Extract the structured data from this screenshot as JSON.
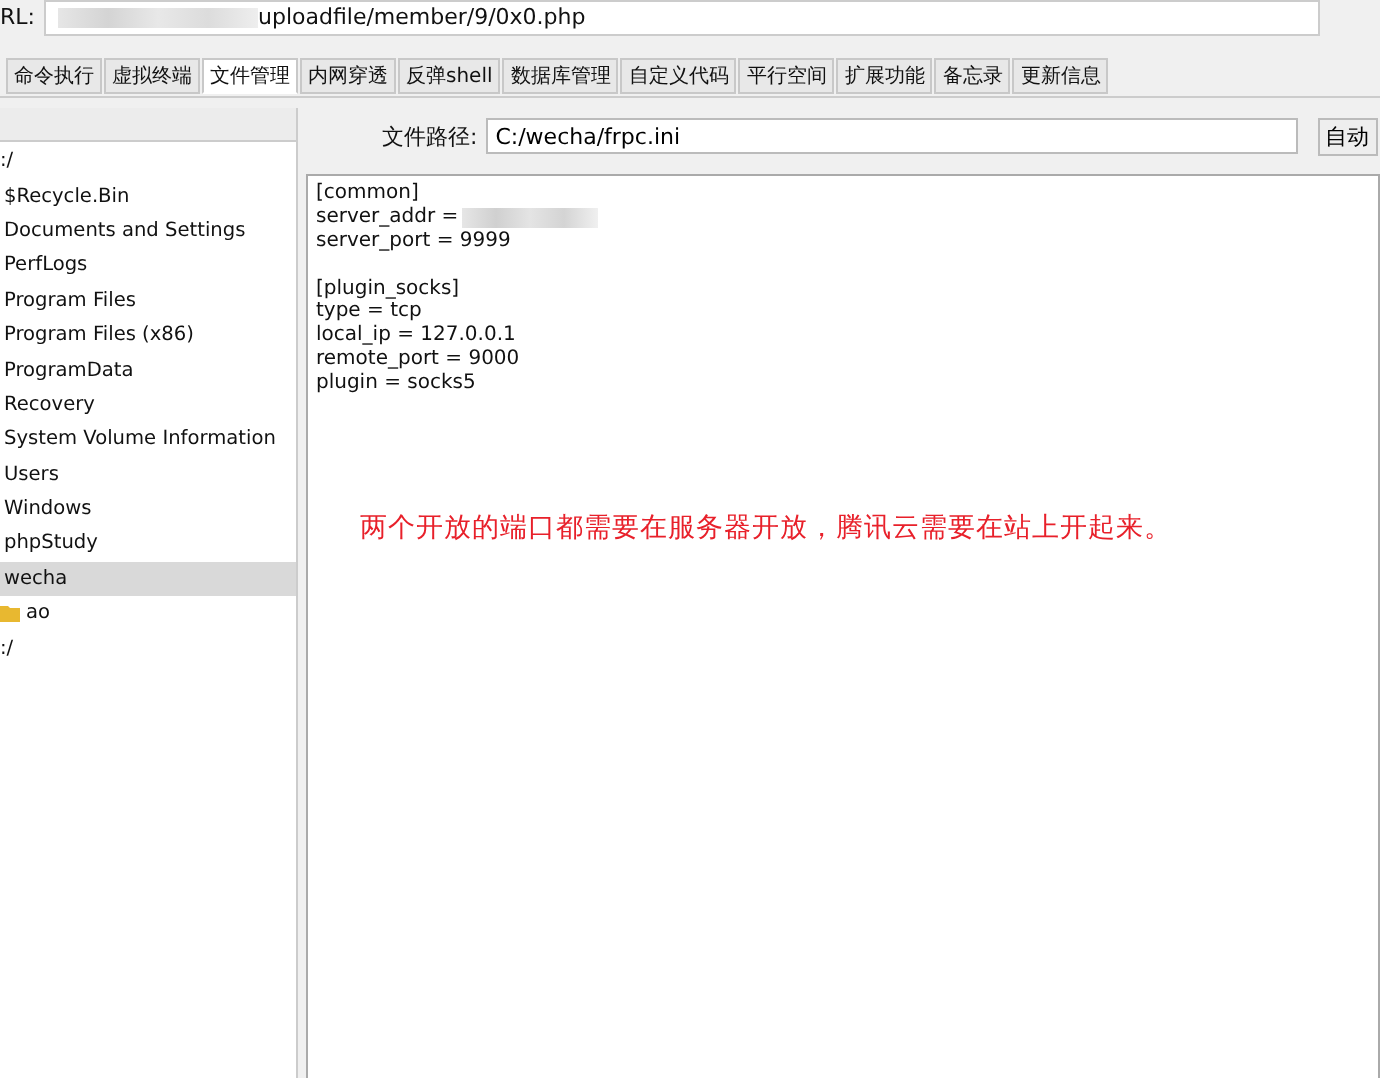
{
  "url_bar": {
    "label": "RL:",
    "value": "uploadfile/member/9/0x0.php",
    "redacted": true
  },
  "tabs": [
    {
      "label": "命令执行",
      "selected": false
    },
    {
      "label": "虚拟终端",
      "selected": false
    },
    {
      "label": "文件管理",
      "selected": true
    },
    {
      "label": "内网穿透",
      "selected": false
    },
    {
      "label": "反弹shell",
      "selected": false
    },
    {
      "label": "数据库管理",
      "selected": false
    },
    {
      "label": "自定义代码",
      "selected": false
    },
    {
      "label": "平行空间",
      "selected": false
    },
    {
      "label": "扩展功能",
      "selected": false
    },
    {
      "label": "备忘录",
      "selected": false
    },
    {
      "label": "更新信息",
      "selected": false
    }
  ],
  "tree": [
    {
      "label": ":/",
      "selected": false,
      "children": [
        {
          "label": "$Recycle.Bin",
          "selected": false
        },
        {
          "label": "Documents and Settings",
          "selected": false
        },
        {
          "label": "PerfLogs",
          "selected": false
        },
        {
          "label": "Program Files",
          "selected": false
        },
        {
          "label": "Program Files (x86)",
          "selected": false
        },
        {
          "label": "ProgramData",
          "selected": false
        },
        {
          "label": "Recovery",
          "selected": false
        },
        {
          "label": "System Volume Information",
          "selected": false
        },
        {
          "label": "Users",
          "selected": false
        },
        {
          "label": "Windows",
          "selected": false
        },
        {
          "label": "phpStudy",
          "selected": false
        },
        {
          "label": "wecha",
          "selected": true,
          "children": [
            {
              "label": "ao",
              "selected": false,
              "kind": "folder"
            }
          ]
        }
      ]
    },
    {
      "label": ":/",
      "selected": false
    }
  ],
  "path_field": {
    "label": "文件路径:",
    "value": "C:/wecha/frpc.ini"
  },
  "auto_button": "自动",
  "editor_lines": [
    {
      "kind": "text",
      "text": "[common]"
    },
    {
      "kind": "text",
      "text": "server_addr =",
      "redacted": true
    },
    {
      "kind": "text",
      "text": "server_port = 9999"
    },
    {
      "kind": "blank"
    },
    {
      "kind": "text",
      "text": "[plugin_socks]"
    },
    {
      "kind": "text",
      "text": "type = tcp"
    },
    {
      "kind": "text",
      "text": "local_ip = 127.0.0.1"
    },
    {
      "kind": "text",
      "text": "remote_port = 9000"
    },
    {
      "kind": "text",
      "text": "plugin = socks5"
    }
  ],
  "annotation": "两个开放的端口都需要在服务器开放，腾讯云需要在站上开起来。"
}
